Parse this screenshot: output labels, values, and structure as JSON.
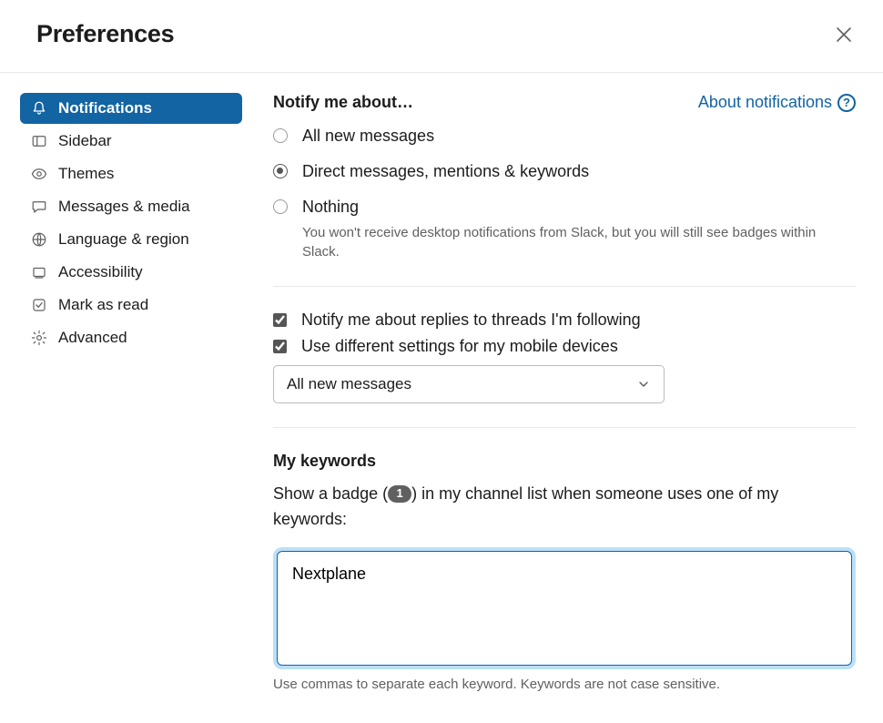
{
  "header": {
    "title": "Preferences"
  },
  "sidebar": {
    "items": [
      {
        "label": "Notifications"
      },
      {
        "label": "Sidebar"
      },
      {
        "label": "Themes"
      },
      {
        "label": "Messages & media"
      },
      {
        "label": "Language & region"
      },
      {
        "label": "Accessibility"
      },
      {
        "label": "Mark as read"
      },
      {
        "label": "Advanced"
      }
    ]
  },
  "main": {
    "notify_title": "Notify me about…",
    "about_link": "About notifications",
    "radios": {
      "all": "All new messages",
      "dm": "Direct messages, mentions & keywords",
      "nothing": "Nothing",
      "nothing_desc": "You won't receive desktop notifications from Slack, but you will still see badges within Slack."
    },
    "checks": {
      "threads": "Notify me about replies to threads I'm following",
      "mobile": "Use different settings for my mobile devices"
    },
    "mobile_select": "All new messages",
    "keywords": {
      "title": "My keywords",
      "desc_pre": "Show a badge (",
      "badge": "1",
      "desc_post": ") in my channel list when someone uses one of my keywords:",
      "value": "Nextplane",
      "hint": "Use commas to separate each keyword. Keywords are not case sensitive."
    }
  }
}
